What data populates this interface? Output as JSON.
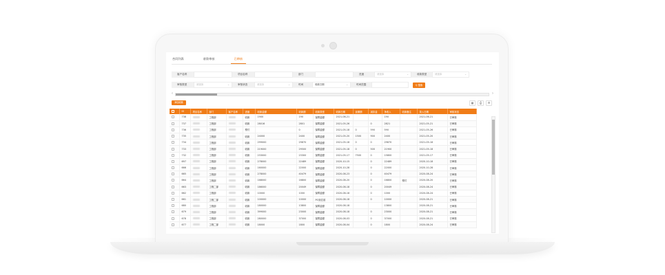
{
  "tabs": [
    {
      "label": "合同列表",
      "active": false
    },
    {
      "label": "收款审核",
      "active": false
    },
    {
      "label": "已审核",
      "active": true
    }
  ],
  "filters": {
    "row1": [
      {
        "label": "客户名称",
        "value": "",
        "placeholder": ""
      },
      {
        "label": "项目名称",
        "value": "",
        "placeholder": ""
      },
      {
        "label": "部门",
        "value": "",
        "placeholder": ""
      },
      {
        "label": "进度",
        "value": "",
        "placeholder": "请选择"
      },
      {
        "label": "收款类型",
        "value": "",
        "placeholder": "请选择"
      }
    ],
    "row2": [
      {
        "label": "审核类型",
        "value": "",
        "placeholder": "请选择"
      },
      {
        "label": "审核状态",
        "value": "",
        "placeholder": "请选择"
      },
      {
        "label": "时间",
        "value": "收款日期",
        "placeholder": ""
      },
      {
        "label": "时间范围",
        "value": "",
        "placeholder": ""
      }
    ],
    "search_label": "Q 搜索"
  },
  "toolbar": {
    "add_label": "添加收款",
    "icons": [
      "filter-icon",
      "print-icon",
      "settings-icon"
    ],
    "icon_glyphs": [
      "▦",
      "⎙",
      "⚙"
    ]
  },
  "table": {
    "headers": [
      "ID",
      "项目名称",
      "部门",
      "客户名称",
      "进度",
      "收款金额",
      "收款额",
      "收款类型",
      "收款日期",
      "延期额",
      "减扣金",
      "净收入",
      "收款备注",
      "录入日期",
      "审核状态"
    ],
    "rows": [
      [
        "738",
        "",
        "工程部",
        "",
        "收款",
        "1900",
        "190",
        "保障金额",
        "2021-06-21",
        "",
        "",
        "190",
        "",
        "2021-06-21",
        "已审核"
      ],
      [
        "737",
        "",
        "工程部",
        "",
        "收款",
        "28016",
        "2801",
        "保障金额",
        "2021-05-26",
        "",
        "0",
        "2821",
        "",
        "2021-05-21",
        "已审核"
      ],
      [
        "736",
        "",
        "工程部",
        "",
        "预付",
        "",
        "0",
        "保障金额",
        "2021-05-18",
        "0",
        "590",
        "590",
        "",
        "2021-05-26",
        "已审核"
      ],
      [
        "735",
        "",
        "工程部",
        "",
        "收款",
        "24000",
        "2400",
        "保障金额",
        "2021-05-20",
        "1500",
        "900",
        "2400",
        "",
        "2021-05-20",
        "已审核"
      ],
      [
        "734",
        "",
        "工程部",
        "",
        "收款",
        "299000",
        "29870",
        "保障金额",
        "2021-05-18",
        "0",
        "0",
        "29870",
        "",
        "2021-05-18",
        "已审核"
      ],
      [
        "733",
        "",
        "工程部",
        "",
        "收款",
        "219000",
        "29500",
        "保障金额",
        "2021-05-18",
        "0",
        "500",
        "21900",
        "",
        "2021-05-18",
        "已审核"
      ],
      [
        "732",
        "",
        "工程部",
        "",
        "收款",
        "233000",
        "23300",
        "保障金额",
        "2021-05-17",
        "7500",
        "0",
        "15800",
        "",
        "2021-05-17",
        "已审核"
      ],
      [
        "697",
        "",
        "工程部",
        "",
        "收款",
        "278000",
        "22489",
        "保障金额",
        "2020-10-15",
        "",
        "0",
        "22489",
        "",
        "2020-10-18",
        "已审核"
      ],
      [
        "666",
        "",
        "工程部",
        "",
        "收款",
        "160000",
        "22000",
        "保障金额",
        "2020-10-28",
        "",
        "0",
        "22000",
        "",
        "2020-10-28",
        "已审核"
      ],
      [
        "665",
        "",
        "工程部",
        "",
        "收款",
        "278000",
        "40479",
        "保障金额",
        "2020-08-23",
        "",
        "0",
        "40479",
        "",
        "2020-08-24",
        "已审核"
      ],
      [
        "664",
        "",
        "工程部",
        "",
        "收款",
        "168000",
        "16800",
        "保障金额",
        "2020-08-20",
        "",
        "0",
        "16800",
        "预付",
        "2020-08-20",
        "已审核"
      ],
      [
        "663",
        "",
        "工程二部",
        "",
        "收款",
        "186000",
        "20049",
        "保障金额",
        "2020-08-18",
        "",
        "0",
        "20049",
        "",
        "2020-08-24",
        "已审核"
      ],
      [
        "662",
        "",
        "工程部",
        "",
        "收款",
        "10000",
        "1000",
        "保障金额",
        "2020-08-18",
        "",
        "0",
        "1000",
        "",
        "2020-08-24",
        "已审核"
      ],
      [
        "661",
        "",
        "工程二部",
        "",
        "收款",
        "100000",
        "10000",
        "PO到达前",
        "2020-08-18",
        "",
        "0",
        "10000",
        "",
        "2020-08-21",
        "已审核"
      ],
      [
        "680",
        "",
        "工程部",
        "",
        "收款",
        "180000",
        "13800",
        "保障金额",
        "2020-08-18",
        "",
        "",
        "13800",
        "",
        "2020-08-21",
        "已审核"
      ],
      [
        "679",
        "",
        "工程部",
        "",
        "收款",
        "399000",
        "23000",
        "保障金额",
        "2020-08-18",
        "",
        "0",
        "23000",
        "",
        "2020-08-21",
        "已审核"
      ],
      [
        "678",
        "",
        "工程部",
        "",
        "收款",
        "280000",
        "37000",
        "保障金额",
        "2020-08-03",
        "",
        "0",
        "37000",
        "",
        "2020-08-21",
        "已审核"
      ],
      [
        "677",
        "",
        "工程二部",
        "",
        "收款",
        "18000",
        "1800",
        "保障金额",
        "2020-08-04",
        "",
        "0",
        "1800",
        "",
        "2020-08-24",
        "已审核"
      ]
    ]
  }
}
